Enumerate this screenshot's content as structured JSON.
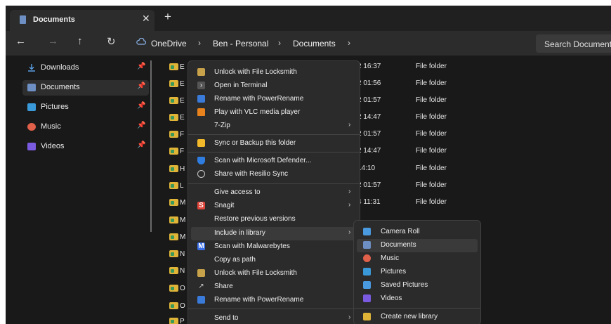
{
  "window": {
    "tab_title": "Documents",
    "close_glyph": "✕",
    "newtab_glyph": "+"
  },
  "nav": {
    "back": "←",
    "forward": "→",
    "up": "↑",
    "refresh": "↻"
  },
  "breadcrumb": {
    "cloud_icon": "cloud-icon",
    "items": [
      "OneDrive",
      "Ben - Personal",
      "Documents"
    ],
    "separator": "›"
  },
  "search": {
    "placeholder": "Search Documents"
  },
  "sidebar": {
    "items": [
      {
        "label": "Downloads",
        "icon": "download-icon",
        "color": "#5aa0e6",
        "pinned": true,
        "selected": false
      },
      {
        "label": "Documents",
        "icon": "documents-icon",
        "color": "#6d8fc4",
        "pinned": true,
        "selected": true
      },
      {
        "label": "Pictures",
        "icon": "pictures-icon",
        "color": "#3a9ad9",
        "pinned": true,
        "selected": false
      },
      {
        "label": "Music",
        "icon": "music-icon",
        "color": "#e0604a",
        "pinned": true,
        "selected": false
      },
      {
        "label": "Videos",
        "icon": "videos-icon",
        "color": "#7a5ae0",
        "pinned": true,
        "selected": false
      }
    ]
  },
  "files": [
    {
      "name": "E",
      "date": "2 16:37",
      "type": "File folder"
    },
    {
      "name": "E",
      "date": "2 01:56",
      "type": "File folder"
    },
    {
      "name": "E",
      "date": "2 01:57",
      "type": "File folder"
    },
    {
      "name": "E",
      "date": "2 14:47",
      "type": "File folder"
    },
    {
      "name": "F",
      "date": "2 01:57",
      "type": "File folder"
    },
    {
      "name": "F",
      "date": "2 14:47",
      "type": "File folder"
    },
    {
      "name": "H",
      "date": "14:10",
      "type": "File folder"
    },
    {
      "name": "L",
      "date": "2 01:57",
      "type": "File folder"
    },
    {
      "name": "M",
      "date": "4 11:31",
      "type": "File folder"
    },
    {
      "name": "M",
      "date": "",
      "type": ""
    },
    {
      "name": "M",
      "date": "",
      "type": ""
    },
    {
      "name": "N",
      "date": "",
      "type": ""
    },
    {
      "name": "N",
      "date": "",
      "type": ""
    },
    {
      "name": "O",
      "date": "",
      "type": ""
    },
    {
      "name": "O",
      "date": "",
      "type": ""
    },
    {
      "name": "P",
      "date": "",
      "type": ""
    }
  ],
  "context_menu": {
    "items": [
      {
        "label": "Unlock with File Locksmith",
        "icon": "lock-icon",
        "color": "#c8a24a"
      },
      {
        "label": "Open in Terminal",
        "icon": "terminal-icon",
        "color": "#555555"
      },
      {
        "label": "Rename with PowerRename",
        "icon": "powerrename-icon",
        "color": "#3a7ad9"
      },
      {
        "label": "Play with VLC media player",
        "icon": "vlc-icon",
        "color": "#e8821c"
      },
      {
        "label": "7-Zip",
        "icon": "",
        "color": "",
        "submenu": true
      },
      {
        "label": "Sync or Backup this folder",
        "icon": "google-drive-icon",
        "color": "#f2b92a"
      },
      {
        "label": "Scan with Microsoft Defender...",
        "icon": "defender-icon",
        "color": "#2f7de0"
      },
      {
        "label": "Share with Resilio Sync",
        "icon": "resilio-icon",
        "color": "#cccccc"
      },
      {
        "label": "Give access to",
        "icon": "",
        "color": "",
        "submenu": true
      },
      {
        "label": "Snagit",
        "icon": "snagit-icon",
        "color": "#e0453a",
        "submenu": true
      },
      {
        "label": "Restore previous versions",
        "icon": "",
        "color": ""
      },
      {
        "label": "Include in library",
        "icon": "",
        "color": "",
        "submenu": true,
        "highlighted": true
      },
      {
        "label": "Scan with Malwarebytes",
        "icon": "malwarebytes-icon",
        "color": "#3a6ee8"
      },
      {
        "label": "Copy as path",
        "icon": "",
        "color": ""
      },
      {
        "label": "Unlock with File Locksmith",
        "icon": "lock-icon",
        "color": "#c8a24a"
      },
      {
        "label": "Share",
        "icon": "share-icon",
        "color": "#cccccc"
      },
      {
        "label": "Rename with PowerRename",
        "icon": "powerrename-icon",
        "color": "#3a7ad9"
      },
      {
        "label": "Send to",
        "icon": "",
        "color": "",
        "submenu": true
      }
    ],
    "submenu_arrow": "›"
  },
  "library_submenu": {
    "items": [
      {
        "label": "Camera Roll",
        "icon": "camera-roll-icon",
        "color": "#4a9ae0"
      },
      {
        "label": "Documents",
        "icon": "documents-icon",
        "color": "#6d8fc4",
        "highlighted": true
      },
      {
        "label": "Music",
        "icon": "music-icon",
        "color": "#e0604a"
      },
      {
        "label": "Pictures",
        "icon": "pictures-icon",
        "color": "#3a9ad9"
      },
      {
        "label": "Saved Pictures",
        "icon": "saved-pictures-icon",
        "color": "#4a9ae0"
      },
      {
        "label": "Videos",
        "icon": "videos-icon",
        "color": "#7a5ae0"
      },
      {
        "label": "Create new library",
        "icon": "new-library-icon",
        "color": "#e0b437"
      }
    ]
  }
}
